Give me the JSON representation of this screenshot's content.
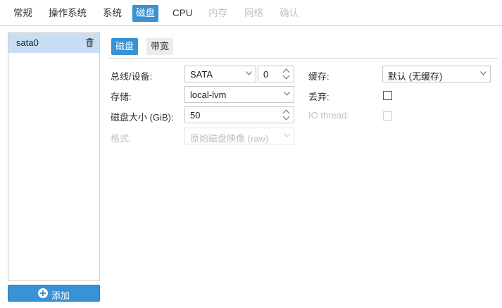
{
  "tabs": [
    {
      "label": "常规",
      "state": "normal"
    },
    {
      "label": "操作系统",
      "state": "normal"
    },
    {
      "label": "系统",
      "state": "normal"
    },
    {
      "label": "磁盘",
      "state": "active"
    },
    {
      "label": "CPU",
      "state": "normal"
    },
    {
      "label": "内存",
      "state": "disabled"
    },
    {
      "label": "网络",
      "state": "disabled"
    },
    {
      "label": "确认",
      "state": "disabled"
    }
  ],
  "disk_list": {
    "items": [
      {
        "label": "sata0",
        "icon": "trash-icon"
      }
    ],
    "add_button_label": "添加",
    "add_icon": "plus-circle-icon"
  },
  "subtabs": {
    "disk": "磁盘",
    "bandwidth": "带宽"
  },
  "form": {
    "bus_device_label": "总线/设备:",
    "bus_value": "SATA",
    "device_number": "0",
    "storage_label": "存储:",
    "storage_value": "local-lvm",
    "disk_size_label": "磁盘大小 (GiB):",
    "disk_size_value": "50",
    "format_label": "格式:",
    "format_value": "原始磁盘映像 (raw)",
    "cache_label": "缓存:",
    "cache_value": "默认 (无缓存)",
    "discard_label": "丢弃:",
    "discard_checked": false,
    "io_thread_label": "IO thread:",
    "io_thread_checked": false
  },
  "colors": {
    "accent": "#3892d4",
    "selected_row": "#c7def5",
    "disabled_text": "#c0c0c0"
  }
}
